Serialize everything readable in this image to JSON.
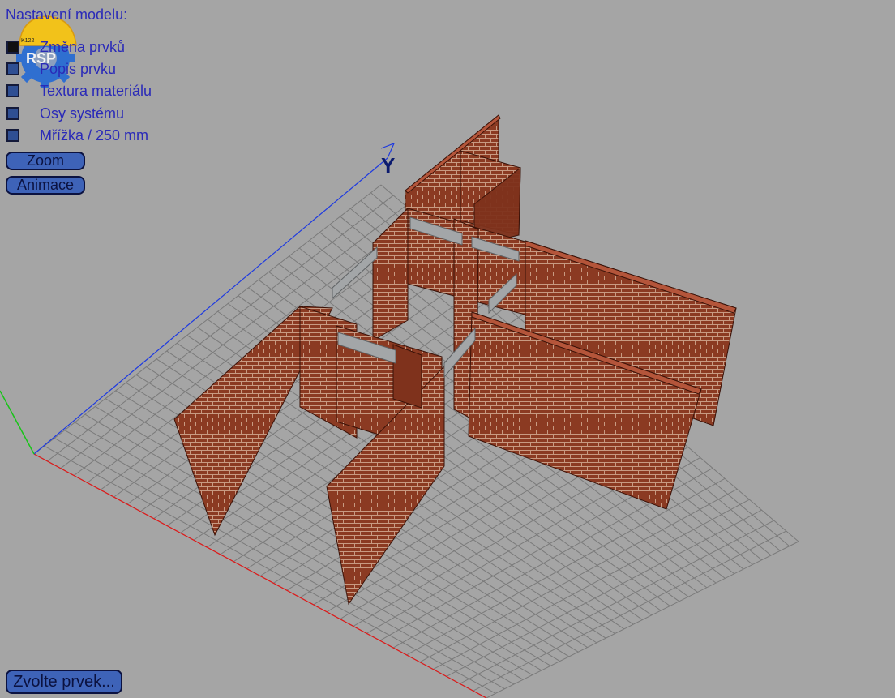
{
  "panel": {
    "title": "Nastavení modelu:",
    "options": [
      {
        "label": "Změna prvků",
        "checked": true
      },
      {
        "label": "Popis prvku",
        "checked": false
      },
      {
        "label": "Textura materiálu",
        "checked": false
      },
      {
        "label": "Osy systému",
        "checked": false
      },
      {
        "label": "Mřížka / 250 mm",
        "checked": false
      }
    ],
    "zoom_label": "Zoom",
    "animation_label": "Animace"
  },
  "logo": {
    "code": "K122",
    "text": "RSP"
  },
  "axis": {
    "y_label": "Y"
  },
  "bottom_button_label": "Zvolte prvek...",
  "colors": {
    "background": "#a5a5a5",
    "grid_line": "#7a7a7a",
    "brick": "#8b3a22",
    "mortar": "#c89a82",
    "lintel": "#a3a6a8",
    "axis_x": "#e01818",
    "axis_y": "#1e3ae0",
    "axis_z": "#18c418",
    "label_text": "#2a2ab8"
  },
  "icons": [
    "gear-icon",
    "helmet-icon"
  ]
}
